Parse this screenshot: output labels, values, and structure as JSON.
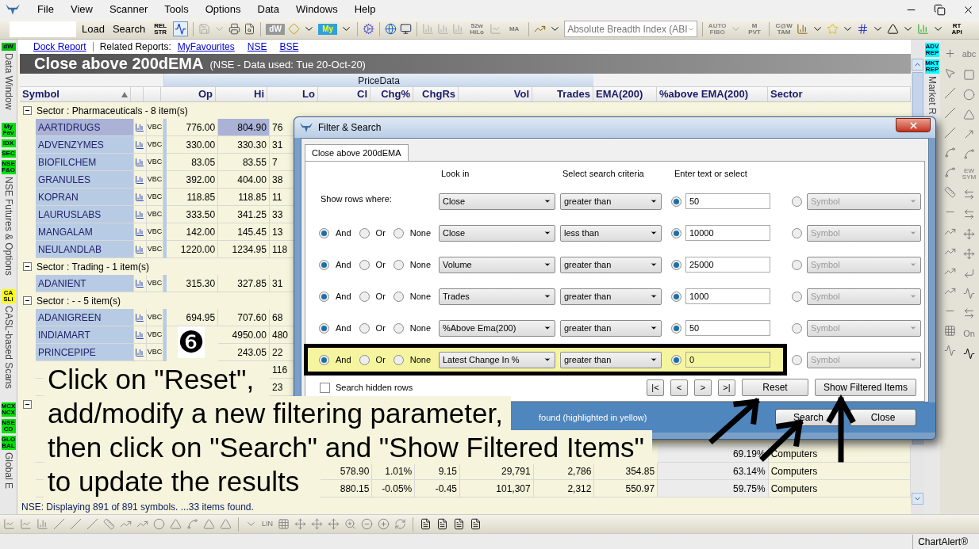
{
  "menu": [
    "File",
    "View",
    "Scanner",
    "Tools",
    "Options",
    "Data",
    "Windows",
    "Help"
  ],
  "toolbar": {
    "buttons": [
      "Load",
      "Search"
    ],
    "glyphs": [
      "REL STR",
      "dW",
      "My",
      "52w HiLo",
      "MA",
      "AUTO FIBO",
      "M PVT",
      "C@W TAM",
      "RT API"
    ],
    "indicator_select": "Absolute Breadth Index (ABI"
  },
  "left_strip": [
    {
      "kind": "badge",
      "label": "dW",
      "color": "#00c000"
    },
    {
      "kind": "vertical",
      "label": "Data Window"
    },
    {
      "kind": "badge",
      "label": "My Fav",
      "color": "#00e000"
    },
    {
      "kind": "badge",
      "label": "IDX",
      "color": "#00e000"
    },
    {
      "kind": "badge",
      "label": "SEC",
      "color": "#00e000"
    },
    {
      "kind": "badge",
      "label": "NSE F&O",
      "color": "#00e000"
    },
    {
      "kind": "vertical",
      "label": "NSE Futures & Options"
    },
    {
      "kind": "badge",
      "label": "CA SLi",
      "color": "#ffff00"
    },
    {
      "kind": "vertical",
      "label": "CASL-based Scans"
    },
    {
      "kind": "badge",
      "label": "MCX NCX",
      "color": "#00e000"
    },
    {
      "kind": "badge",
      "label": "NSE CD",
      "color": "#00e000"
    },
    {
      "kind": "badge",
      "label": "GLO BAL",
      "color": "#00e000"
    },
    {
      "kind": "vertical",
      "label": "Global E"
    }
  ],
  "right_strip": [
    {
      "kind": "badge",
      "label": "ADV REP",
      "color": "#00ffff"
    },
    {
      "kind": "badge",
      "label": "MKT REP",
      "color": "#00ffff"
    },
    {
      "kind": "vertical",
      "label": "Market R"
    }
  ],
  "right_tools": {
    "glyphs": [
      "abc",
      "EW SYM",
      "On"
    ]
  },
  "reports_bar": {
    "dock_link": "Dock Report",
    "label": "Related Reports:",
    "links": [
      "MyFavourites",
      "NSE",
      "BSE"
    ]
  },
  "report_title": {
    "title": "Close above 200dEMA",
    "subtitle": "(NSE - Data used: Tue 20-Oct-20)"
  },
  "table": {
    "header_group": "PriceData",
    "columns": [
      "Symbol",
      "Op",
      "Hi",
      "Lo",
      "Cl",
      "Chg%",
      "ChgRs",
      "Vol",
      "Trades",
      "EMA(200)",
      "%above EMA(200)",
      "Sector"
    ],
    "groups": [
      {
        "label": "Sector : Pharmaceuticals - 8 item(s)",
        "expanded": true,
        "rows": [
          {
            "symbol": "AARTIDRUGS",
            "tag": "VBC",
            "selected": true,
            "cells": [
              "776.00",
              "804.90",
              "76",
              null,
              null,
              null,
              null,
              null,
              null,
              null,
              null
            ]
          },
          {
            "symbol": "ADVENZYMES",
            "tag": "VBC",
            "selected": false,
            "cells": [
              "330.00",
              "330.30",
              "31",
              null,
              null,
              null,
              null,
              null,
              null,
              null,
              null
            ]
          },
          {
            "symbol": "BIOFILCHEM",
            "tag": "VBC",
            "selected": false,
            "cells": [
              "83.05",
              "83.55",
              "7",
              null,
              null,
              null,
              null,
              null,
              null,
              null,
              null
            ]
          },
          {
            "symbol": "GRANULES",
            "tag": "VBC",
            "selected": false,
            "cells": [
              "392.00",
              "404.00",
              "38",
              null,
              null,
              null,
              null,
              null,
              null,
              null,
              null
            ]
          },
          {
            "symbol": "KOPRAN",
            "tag": "VBC",
            "selected": false,
            "cells": [
              "118.85",
              "118.85",
              "11",
              null,
              null,
              null,
              null,
              null,
              null,
              null,
              null
            ]
          },
          {
            "symbol": "LAURUSLABS",
            "tag": "VBC",
            "selected": false,
            "cells": [
              "333.50",
              "341.25",
              "33",
              null,
              null,
              null,
              null,
              null,
              null,
              null,
              null
            ]
          },
          {
            "symbol": "MANGALAM",
            "tag": "VBC",
            "selected": false,
            "cells": [
              "142.00",
              "145.45",
              "13",
              null,
              null,
              null,
              null,
              null,
              null,
              null,
              null
            ]
          },
          {
            "symbol": "NEULANDLAB",
            "tag": "VBC",
            "selected": false,
            "cells": [
              "1220.00",
              "1234.95",
              "118",
              null,
              null,
              null,
              null,
              null,
              null,
              null,
              null
            ]
          }
        ]
      },
      {
        "label": "Sector : Trading - 1 item(s)",
        "expanded": true,
        "rows": [
          {
            "symbol": "ADANIENT",
            "tag": "VBC",
            "selected": false,
            "cells": [
              "315.30",
              "327.85",
              "31",
              null,
              null,
              null,
              null,
              null,
              null,
              null,
              null
            ]
          }
        ]
      },
      {
        "label": "Sector : - - 5 item(s)",
        "expanded": true,
        "rows": [
          {
            "symbol": "ADANIGREEN",
            "tag": "VBC",
            "selected": false,
            "cells": [
              "694.95",
              "707.60",
              "68",
              null,
              null,
              null,
              null,
              null,
              null,
              null,
              null
            ]
          },
          {
            "symbol": "INDIAMART",
            "tag": "VBC",
            "selected": false,
            "cells": [
              null,
              "4950.00",
              "480",
              null,
              null,
              null,
              null,
              null,
              null,
              null,
              null
            ]
          },
          {
            "symbol": "PRINCEPIPE",
            "tag": "VBC",
            "selected": false,
            "cells": [
              null,
              "243.05",
              "22",
              null,
              null,
              null,
              null,
              null,
              null,
              null,
              null
            ]
          },
          {
            "cells": [
              null,
              null,
              "116",
              null,
              null,
              null,
              null,
              null,
              null,
              null,
              null
            ]
          },
          {
            "cells": [
              null,
              null,
              "23",
              null,
              null,
              null,
              null,
              null,
              null,
              null,
              null
            ]
          }
        ]
      },
      {
        "expanded": true,
        "rows": [
          {
            "cells": [
              null,
              null,
              null,
              null,
              null,
              null,
              null,
              null,
              null,
              "69.19%",
              "Computers"
            ]
          },
          {
            "cells": [
              null,
              null,
              null,
              "578.90",
              "1.01%",
              "9.15",
              "29,791",
              "2,786",
              "354.85",
              "63.14%",
              "Computers"
            ]
          },
          {
            "cells": [
              null,
              null,
              null,
              "880.15",
              "-0.05%",
              "-0.45",
              "101,307",
              "2,312",
              "550.97",
              "59.75%",
              "Computers"
            ]
          }
        ]
      }
    ]
  },
  "table_status": "NSE: Displaying 891 of 891 symbols. ...33 items found.",
  "bottom_toolbar": {
    "glyphs": [
      "LIN"
    ]
  },
  "status_bar": "ChartAlert®",
  "dialog": {
    "title": "Filter & Search",
    "tabs": [
      {
        "label": "Close above 200dEMA",
        "selected": true
      }
    ],
    "headers": [
      "Look in",
      "Select search criteria",
      "Enter text or select"
    ],
    "first_label": "Show rows where:",
    "rows": [
      {
        "look_in": "Close",
        "criteria": "greater than",
        "value": "50",
        "use_text": true,
        "alt": "Symbol",
        "highlighted": false
      },
      {
        "connectors": [
          {
            "label": "And",
            "selected": true
          },
          {
            "label": "Or",
            "selected": false
          },
          {
            "label": "None",
            "selected": false
          }
        ],
        "look_in": "Close",
        "criteria": "less than",
        "value": "10000",
        "use_text": true,
        "alt": "Symbol",
        "highlighted": false
      },
      {
        "connectors": [
          {
            "label": "And",
            "selected": true
          },
          {
            "label": "Or",
            "selected": false
          },
          {
            "label": "None",
            "selected": false
          }
        ],
        "look_in": "Volume",
        "criteria": "greater than",
        "value": "25000",
        "use_text": true,
        "alt": "Symbol",
        "highlighted": false
      },
      {
        "connectors": [
          {
            "label": "And",
            "selected": true
          },
          {
            "label": "Or",
            "selected": false
          },
          {
            "label": "None",
            "selected": false
          }
        ],
        "look_in": "Trades",
        "criteria": "greater than",
        "value": "1000",
        "use_text": true,
        "alt": "Symbol",
        "highlighted": false
      },
      {
        "connectors": [
          {
            "label": "And",
            "selected": true
          },
          {
            "label": "Or",
            "selected": false
          },
          {
            "label": "None",
            "selected": false
          }
        ],
        "look_in": "%Above Ema(200)",
        "criteria": "greater than",
        "value": "50",
        "use_text": true,
        "alt": "Symbol",
        "highlighted": false
      },
      {
        "connectors": [
          {
            "label": "And",
            "selected": true
          },
          {
            "label": "Or",
            "selected": false
          },
          {
            "label": "None",
            "selected": false
          }
        ],
        "look_in": "Latest Change In %",
        "criteria": "greater than",
        "value": "0",
        "use_text": true,
        "alt": "Symbol",
        "highlighted": true
      }
    ],
    "search_hidden": {
      "label": "Search hidden rows",
      "checked": false
    },
    "nav_buttons": [
      "|<",
      "<",
      ">",
      ">|"
    ],
    "actions": [
      "Reset",
      "Show Filtered Items"
    ],
    "footer_text": "found (highlighted in yellow)",
    "footer_buttons": [
      "Search",
      "Close"
    ]
  },
  "callout": {
    "number": "❻",
    "lines": [
      "Click on \"Reset\",",
      "add/modify a new filtering parameter,",
      "then click on \"Search\" and \"Show Filtered Items\"",
      "to update the results"
    ]
  }
}
